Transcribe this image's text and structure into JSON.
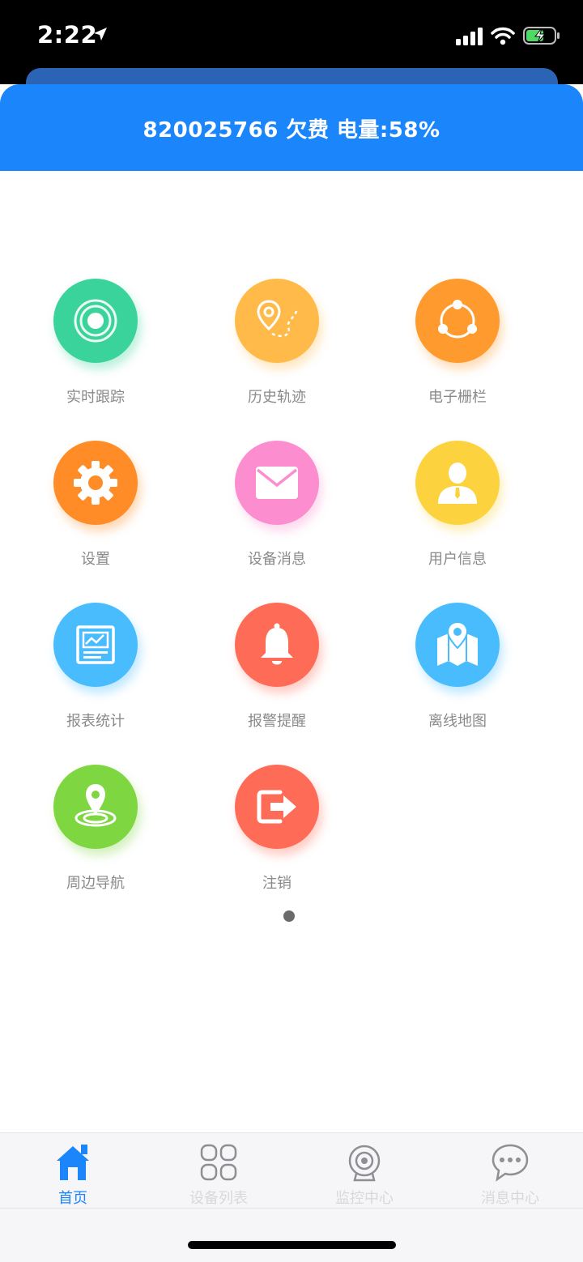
{
  "status_bar": {
    "time": "2:22"
  },
  "header": {
    "title": "820025766 欠费 电量:58%"
  },
  "menu": {
    "items": [
      {
        "label": "实时跟踪",
        "icon": "target-icon",
        "color": "#3ad39b"
      },
      {
        "label": "历史轨迹",
        "icon": "route-pin-icon",
        "color": "#ffba4a"
      },
      {
        "label": "电子栅栏",
        "icon": "share-nodes-icon",
        "color": "#ff9a2f"
      },
      {
        "label": "设置",
        "icon": "gear-icon",
        "color": "#ff8c26"
      },
      {
        "label": "设备消息",
        "icon": "envelope-icon",
        "color": "#fc8ecf"
      },
      {
        "label": "用户信息",
        "icon": "user-icon",
        "color": "#fdd23f"
      },
      {
        "label": "报表统计",
        "icon": "report-chart-icon",
        "color": "#49bcfe"
      },
      {
        "label": "报警提醒",
        "icon": "bell-icon",
        "color": "#fe6b56"
      },
      {
        "label": "离线地图",
        "icon": "map-pin-icon",
        "color": "#49bcfe"
      },
      {
        "label": "周边导航",
        "icon": "nearby-pin-icon",
        "color": "#7ed640"
      },
      {
        "label": "注销",
        "icon": "logout-icon",
        "color": "#fe6b56"
      }
    ]
  },
  "tabbar": {
    "tabs": [
      {
        "label": "首页",
        "icon": "home-icon",
        "active": true
      },
      {
        "label": "设备列表",
        "icon": "grid-icon",
        "active": false
      },
      {
        "label": "监控中心",
        "icon": "webcam-icon",
        "active": false
      },
      {
        "label": "消息中心",
        "icon": "chat-bubble-icon",
        "active": false
      }
    ]
  },
  "colors": {
    "accent": "#1b85fb",
    "status_bar_bg": "#000000"
  }
}
